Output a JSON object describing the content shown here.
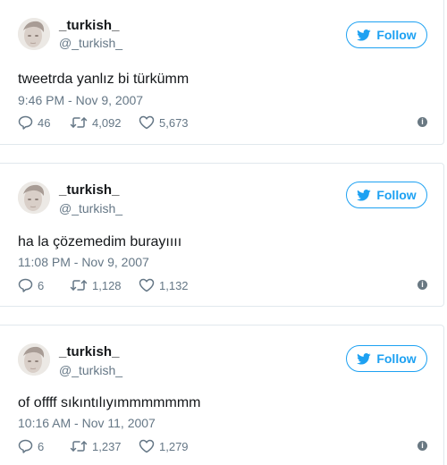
{
  "colors": {
    "accent": "#1da1f2",
    "text": "#14171a",
    "secondary": "#657786",
    "border": "#e1e8ed"
  },
  "tweets": [
    {
      "display_name": "_turkish_",
      "handle": "@_turkish_",
      "follow_label": "Follow",
      "text": "tweetrda yanlız bi türkümm",
      "timestamp": "9:46 PM - Nov 9, 2007",
      "replies": "46",
      "retweets": "4,092",
      "likes": "5,673"
    },
    {
      "display_name": "_turkish_",
      "handle": "@_turkish_",
      "follow_label": "Follow",
      "text": "ha la çözemedim burayıııı",
      "timestamp": "11:08 PM - Nov 9, 2007",
      "replies": "6",
      "retweets": "1,128",
      "likes": "1,132"
    },
    {
      "display_name": "_turkish_",
      "handle": "@_turkish_",
      "follow_label": "Follow",
      "text": "of offff sıkıntılıyımmmmmmm",
      "timestamp": "10:16 AM - Nov 11, 2007",
      "replies": "6",
      "retweets": "1,237",
      "likes": "1,279"
    }
  ],
  "icons": {
    "follow": "twitter-bird-icon",
    "reply": "reply-bubble-icon",
    "retweet": "retweet-icon",
    "like": "heart-icon",
    "info": "info-icon"
  }
}
